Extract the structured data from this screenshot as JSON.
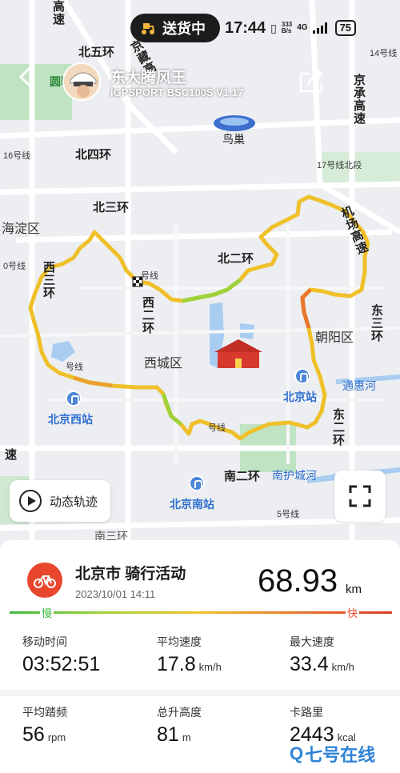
{
  "status_bar": {
    "delivery_label": "送货中",
    "time": "17:44",
    "net_speed_top": "333",
    "net_speed_bottom": "B/s",
    "network": "4G",
    "battery": "75"
  },
  "header": {
    "username": "东大腾风王",
    "device": "iGPSPORT BSC100S  V1.17"
  },
  "map": {
    "labels": {
      "yuanming": "圆明",
      "beiwuhuan": "北五环",
      "beisihuan": "北四环",
      "beisanhuan": "北三环",
      "beierhuan": "北二环",
      "xierhuan": "西二环",
      "xisanhuan": "西三环",
      "dongerhuan": "东二环",
      "dongsanhuan": "东三环",
      "nanerhuan": "南二环",
      "nanhuchenghe": "南护城河",
      "tonghuihe": "通惠河",
      "haidian": "海淀区",
      "xicheng": "西城区",
      "chaoyang": "朝阳区",
      "niaochao": "鸟巢",
      "jichang": "机场高速",
      "jingcheng": "京承高速",
      "jingzang": "京藏高",
      "line16": "16号线",
      "line17": "17号线北段",
      "line14": "14号线",
      "line10": "0号线",
      "line5": "5号线",
      "line_a": "号线",
      "line_b": "号线",
      "line_c": "号线",
      "gaosu": "高速",
      "su_left": "速",
      "beijing_west": "北京西站",
      "beijing_south": "北京南站",
      "beijing_station": "北京站",
      "nansanhuan": "南三环"
    },
    "route_color": "#f0c02a",
    "track_button_label": "动态轨迹"
  },
  "activity": {
    "title": "北京市 骑行活动",
    "datetime": "2023/10/01 14:11",
    "distance": "68.93",
    "distance_unit": "km",
    "slow_label": "慢",
    "fast_label": "快",
    "accent_color": "#e8472d"
  },
  "stats": [
    {
      "label": "移动时间",
      "value": "03:52:51",
      "unit": ""
    },
    {
      "label": "平均速度",
      "value": "17.8",
      "unit": "km/h"
    },
    {
      "label": "最大速度",
      "value": "33.4",
      "unit": "km/h"
    },
    {
      "label": "平均踏频",
      "value": "56",
      "unit": "rpm"
    },
    {
      "label": "总升高度",
      "value": "81",
      "unit": "m"
    },
    {
      "label": "卡路里",
      "value": "2443",
      "unit": "kcal"
    }
  ],
  "watermark": {
    "text": "七号在线",
    "letter": "Q"
  }
}
